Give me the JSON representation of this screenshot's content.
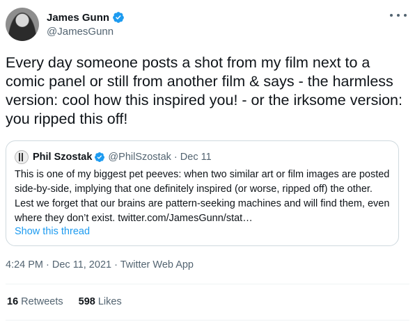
{
  "tweet": {
    "author_name": "James Gunn",
    "author_handle": "@JamesGunn",
    "text": "Every day someone posts a shot from my film next to a comic panel or still from another film & says - the harmless version: cool how this inspired you! - or the irksome version: you ripped this off!",
    "timestamp": "4:24 PM · Dec 11, 2021 · Twitter Web App"
  },
  "quoted": {
    "author_name": "Phil Szostak",
    "meta": "@PhilSzostak · Dec 11",
    "text": "This is one of my biggest pet peeves: when two similar art or film images are posted side-by-side, implying that one definitely inspired (or worse, ripped off) the other. Lest we forget that our brains are pattern-seeking machines and will find them, even where they don’t exist. twitter.com/JamesGunn/stat…",
    "thread_link": "Show this thread"
  },
  "stats": {
    "retweets_count": "16",
    "retweets_label": "Retweets",
    "likes_count": "598",
    "likes_label": "Likes"
  },
  "icons": {
    "verified": "verified-badge-icon",
    "more": "more-options-icon"
  },
  "colors": {
    "verified": "#1d9bf0",
    "link": "#1d9bf0",
    "secondary_text": "#536471"
  }
}
